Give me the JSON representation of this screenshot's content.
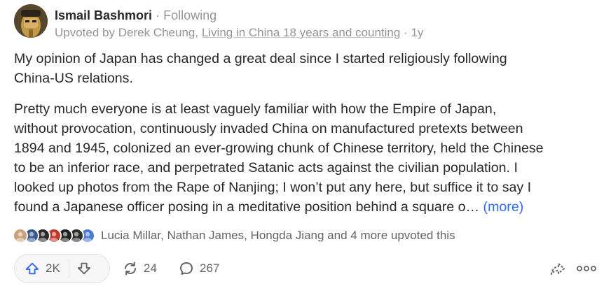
{
  "author": {
    "name": "Ismail Bashmori",
    "follow_status": "Following",
    "separator": "·"
  },
  "meta": {
    "upvoted_by_prefix": "Upvoted by ",
    "upvoter_name": "Derek Cheung",
    "comma": ", ",
    "credential": "Living in China 18 years and counting",
    "separator": " · ",
    "age": "1y"
  },
  "content": {
    "paragraph1": [
      "My opinion of Japan has changed a great deal since I started religiously following",
      "China-US relations."
    ],
    "paragraph2": [
      "Pretty much everyone is at least vaguely familiar with how the Empire of Japan,",
      "without provocation, continuously invaded China on manufactured pretexts between",
      "1894 and 1945, colonized an ever-growing chunk of Chinese territory, held the Chinese",
      "to be an inferior race, and perpetrated Satanic acts against the civilian population. I",
      "looked up photos from the Rape of Nanjing; I won’t put any here, but suffice it to say I",
      "found a Japanese officer posing in a meditative position behind a square o… "
    ],
    "more_label": "(more)"
  },
  "upvoters": {
    "text": "Lucia Millar, Nathan James, Hongda Jiang and 4 more upvoted this",
    "face_colors": [
      "#c9a27a",
      "#3a5a8c",
      "#2a2a2a",
      "#c0392b",
      "#1f1f1f",
      "#2d2d2d",
      "#4a7bd0"
    ]
  },
  "actions": {
    "upvote_count": "2K",
    "share_count": "24",
    "comment_count": "267"
  },
  "colors": {
    "accent_blue": "#2e69ff",
    "text_primary": "#282829",
    "text_secondary": "#939598",
    "icon_gray": "#636466"
  }
}
